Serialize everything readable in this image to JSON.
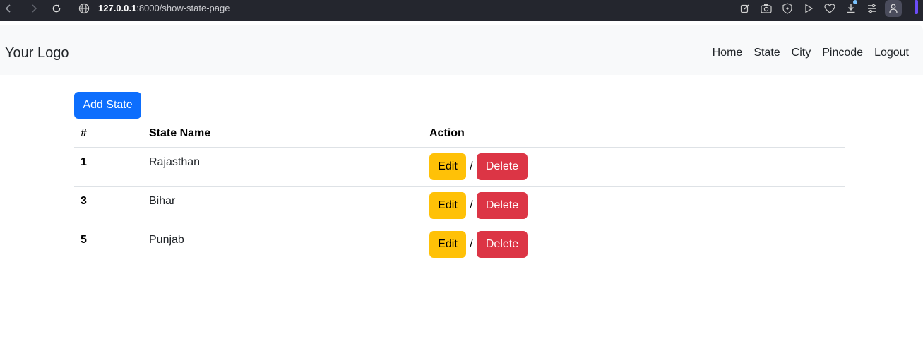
{
  "browser": {
    "url_host": "127.0.0.1",
    "url_rest": ":8000/show-state-page",
    "icons": [
      "back-icon",
      "forward-icon",
      "reload-icon",
      "globe-icon",
      "edit-page-icon",
      "camera-icon",
      "shield-icon",
      "play-icon",
      "heart-icon",
      "download-icon",
      "menu-icon",
      "profile-icon"
    ]
  },
  "navbar": {
    "brand": "Your Logo",
    "links": [
      "Home",
      "State",
      "City",
      "Pincode",
      "Logout"
    ]
  },
  "toolbar": {
    "add_label": "Add State"
  },
  "table": {
    "headers": [
      "#",
      "State Name",
      "Action"
    ],
    "rows": [
      {
        "id": "1",
        "name": "Rajasthan",
        "edit": "Edit",
        "sep": "/",
        "delete": "Delete"
      },
      {
        "id": "3",
        "name": "Bihar",
        "edit": "Edit",
        "sep": "/",
        "delete": "Delete"
      },
      {
        "id": "5",
        "name": "Punjab",
        "edit": "Edit",
        "sep": "/",
        "delete": "Delete"
      }
    ]
  },
  "colors": {
    "primary": "#0d6efd",
    "warning": "#ffc107",
    "danger": "#dc3545",
    "navbar_bg": "#f8f9fa",
    "chrome_bg": "#24262e"
  }
}
